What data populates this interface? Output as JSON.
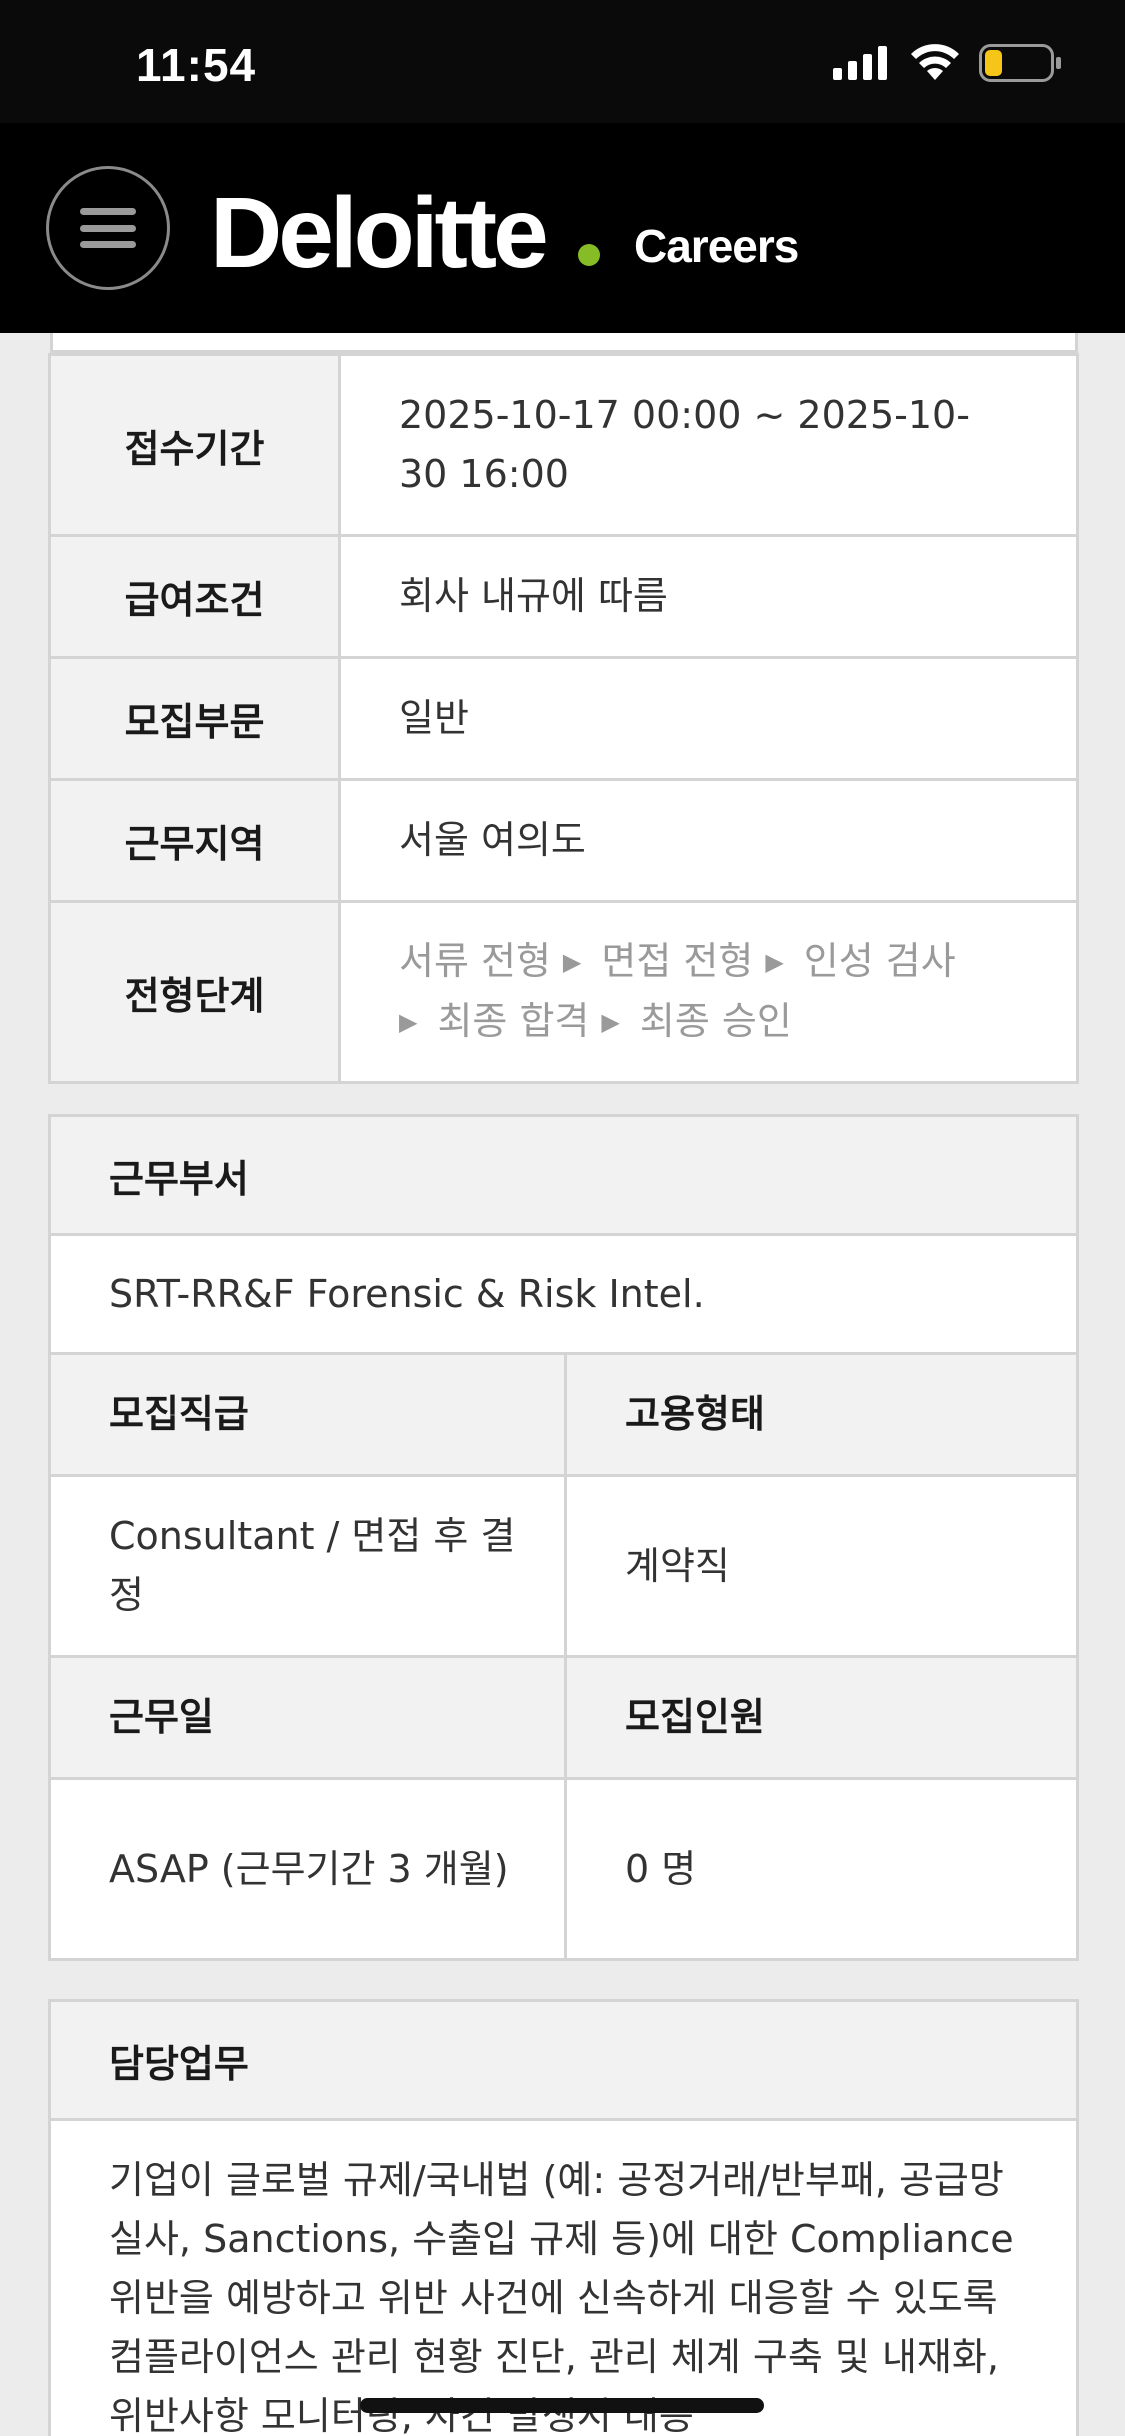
{
  "status_bar": {
    "time": "11:54",
    "icons": [
      "signal-icon",
      "wifi-icon",
      "battery-icon"
    ],
    "battery_color": "#f5c518"
  },
  "header": {
    "brand": "Deloitte",
    "brand_dot_color": "#86bc25",
    "subtitle": "Careers",
    "menu_icon": "hamburger-menu-icon"
  },
  "info_table": [
    {
      "label": "접수기간",
      "value": "2025-10-17 00:00  ~ 2025-10-30 16:00"
    },
    {
      "label": "급여조건",
      "value": "회사 내규에 따름"
    },
    {
      "label": "모집부문",
      "value": "일반"
    },
    {
      "label": "근무지역",
      "value": "서울 여의도"
    },
    {
      "label": "전형단계",
      "steps": [
        "서류 전형",
        "면접 전형",
        "인성 검사",
        "최종 합격",
        "최종 승인"
      ]
    }
  ],
  "department": {
    "label": "근무부서",
    "value": "SRT-RR&F Forensic & Risk Intel."
  },
  "details": {
    "rank_label": "모집직급",
    "type_label": "고용형태",
    "rank_value": "Consultant / 면접 후 결정",
    "type_value": "계약직",
    "workday_label": "근무일",
    "headcount_label": "모집인원",
    "workday_value": "ASAP (근무기간 3 개월)",
    "headcount_value": "0 명"
  },
  "duties": {
    "label": "담당업무",
    "text": "기업이 글로벌 규제/국내법 (예: 공정거래/반부패, 공급망 실사, Sanctions, 수출입 규제 등)에 대한 Compliance 위반을 예방하고 위반 사건에 신속하게 대응할 수 있도록 컴플라이언스 관리 현황 진단, 관리 체계 구축 및 내재화, 위반사항 모니터링, 사건 발생시 대응"
  },
  "colors": {
    "header_bg": "#000000",
    "table_header_bg": "#f2f2f2",
    "border": "#d4d4d4",
    "step_text": "#9a9a9a"
  }
}
